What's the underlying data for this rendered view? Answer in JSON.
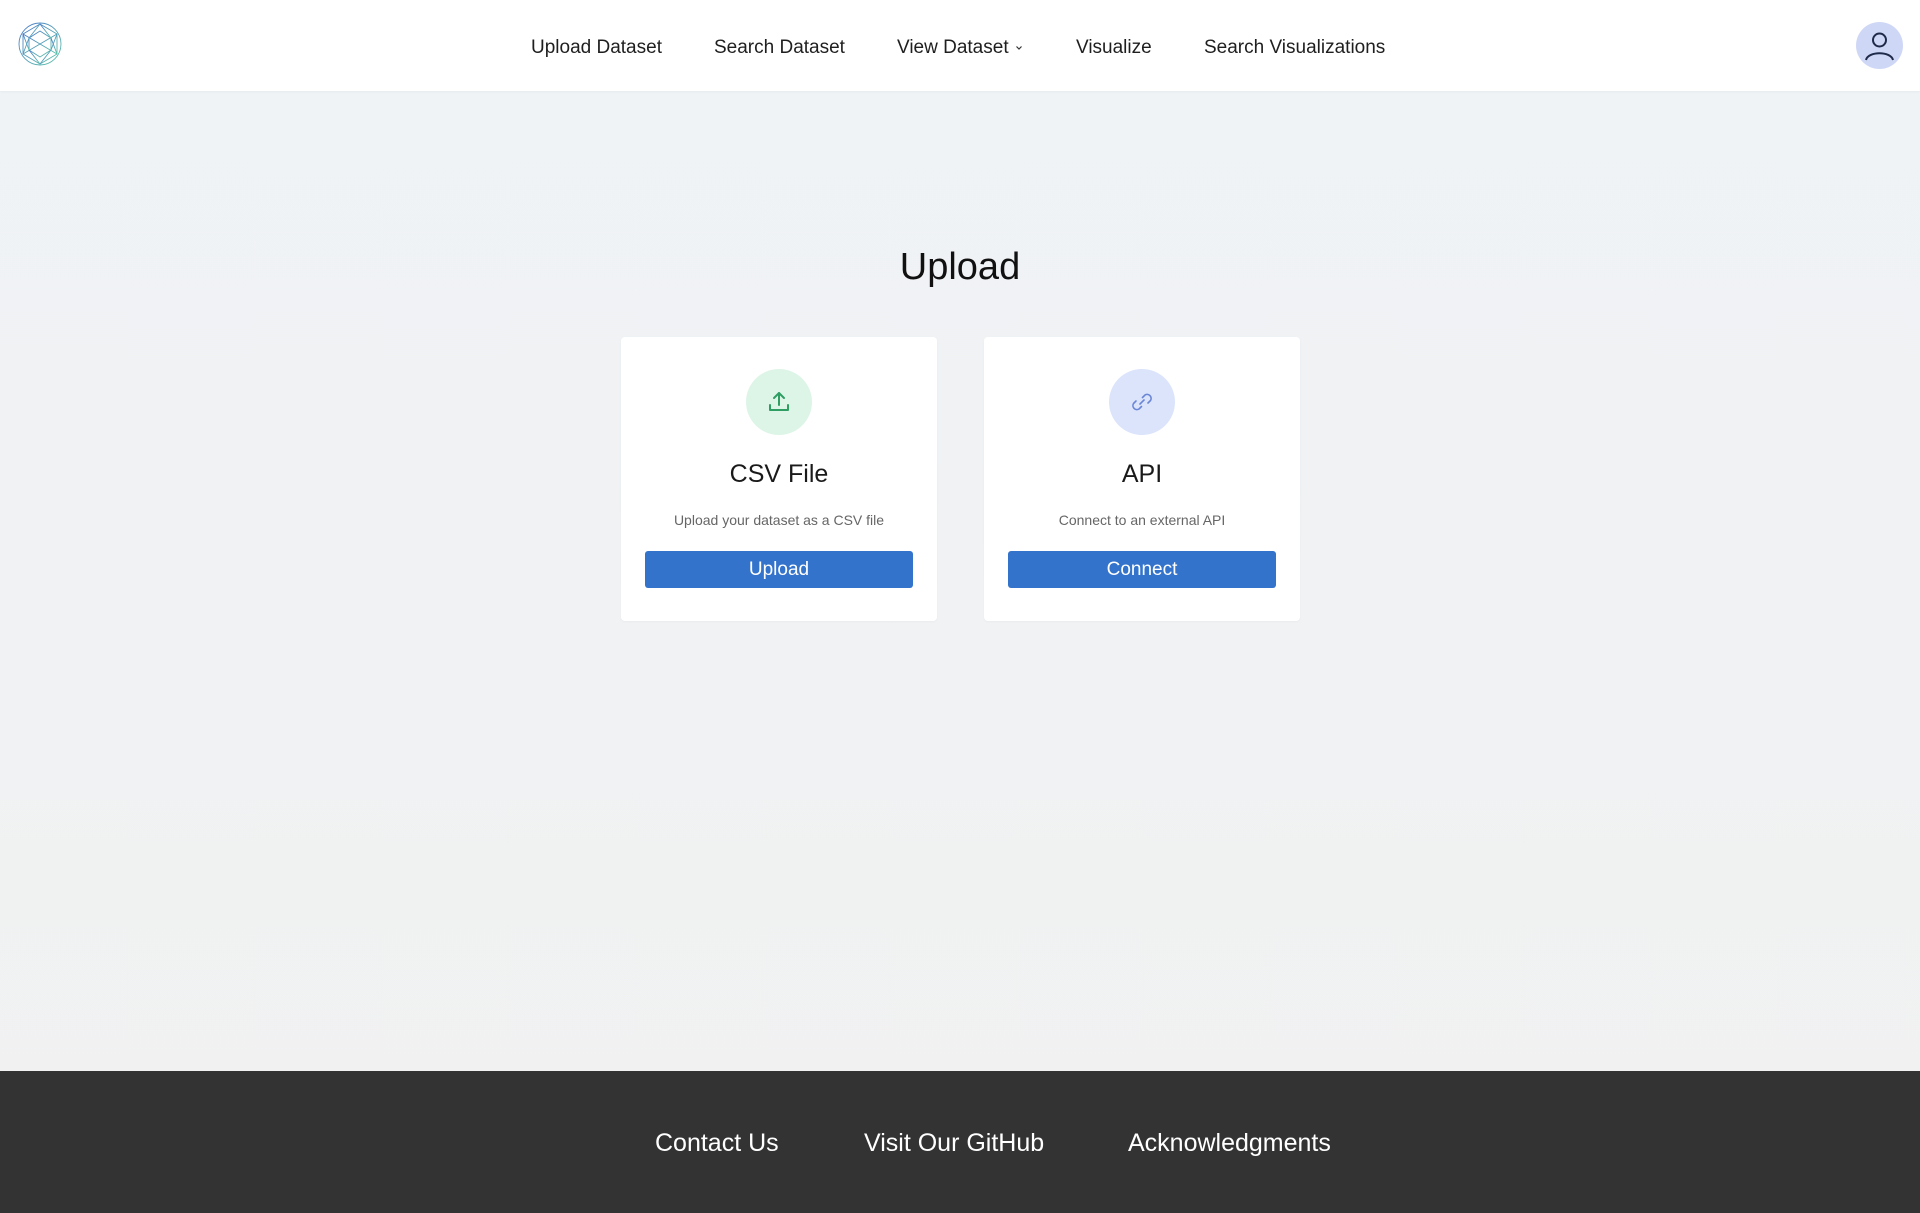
{
  "nav": {
    "items": [
      {
        "label": "Upload Dataset"
      },
      {
        "label": "Search Dataset"
      },
      {
        "label": "View Dataset"
      },
      {
        "label": "Visualize"
      },
      {
        "label": "Search Visualizations"
      }
    ]
  },
  "main": {
    "title": "Upload",
    "cards": [
      {
        "icon": "upload-icon",
        "title": "CSV File",
        "description": "Upload your dataset as a CSV file",
        "button_label": "Upload"
      },
      {
        "icon": "link-icon",
        "title": "API",
        "description": "Connect to an external API",
        "button_label": "Connect"
      }
    ]
  },
  "footer": {
    "links": [
      {
        "label": "Contact Us"
      },
      {
        "label": "Visit Our GitHub"
      },
      {
        "label": "Acknowledgments"
      }
    ]
  },
  "colors": {
    "primary_button": "#3373cc",
    "footer_bg": "#333333",
    "csv_icon_bg": "#ddf5e7",
    "api_icon_bg": "#dbe4fb",
    "avatar_bg": "#cfd7f6"
  }
}
